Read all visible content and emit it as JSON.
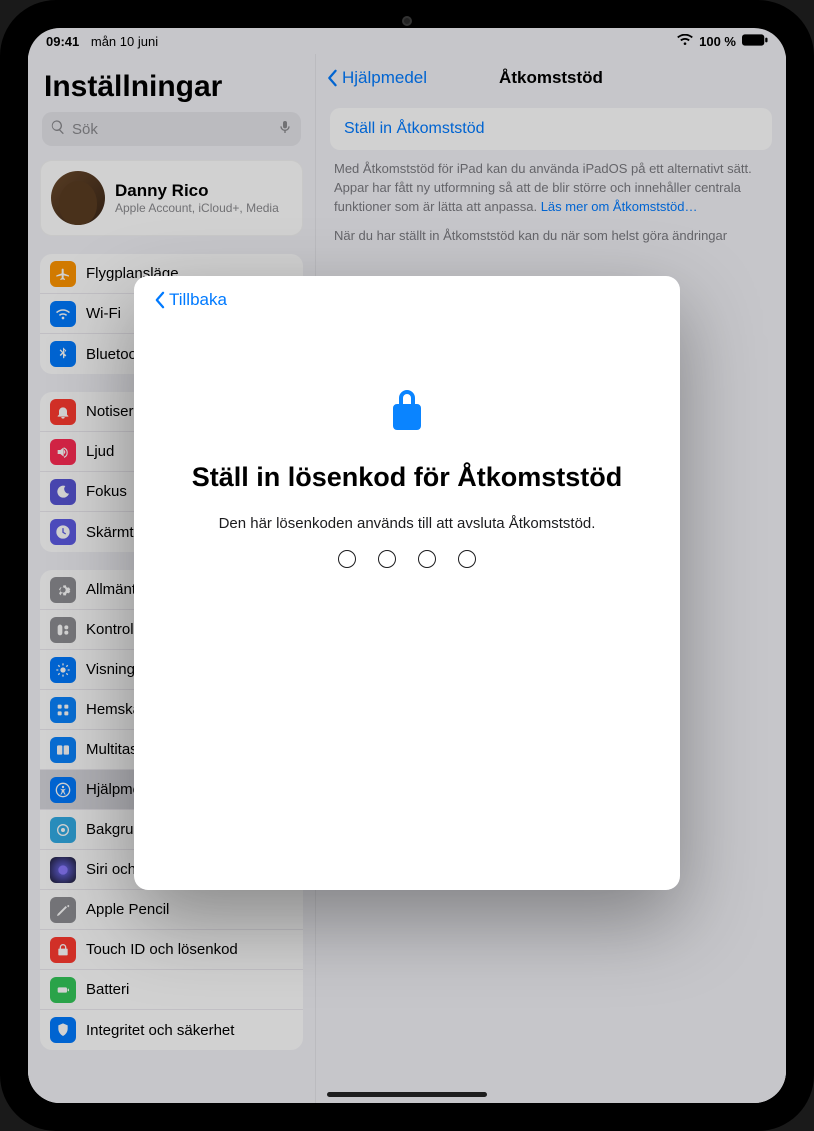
{
  "status": {
    "time": "09:41",
    "date": "mån 10 juni",
    "battery_pct": "100 %"
  },
  "sidebar": {
    "title": "Inställningar",
    "search_placeholder": "Sök",
    "profile": {
      "name": "Danny Rico",
      "sub": "Apple Account, iCloud+, Media"
    },
    "g1": [
      "Flygplansläge",
      "Wi-Fi",
      "Bluetooth"
    ],
    "g2": [
      "Notiser",
      "Ljud",
      "Fokus",
      "Skärmtid"
    ],
    "g3": [
      "Allmänt",
      "Kontrollcenter",
      "Visning och ljusstyrka",
      "Hemskärm och appbibliotek",
      "Multitasking och gester",
      "Hjälpmedel",
      "Bakgrundsbild",
      "Siri och sökning",
      "Apple Pencil",
      "Touch ID och lösenkod",
      "Batteri",
      "Integritet och säkerhet"
    ]
  },
  "detail": {
    "back": "Hjälpmedel",
    "title": "Åtkomststöd",
    "setup": "Ställ in Åtkomststöd",
    "desc1": "Med Åtkomststöd för iPad kan du använda iPadOS på ett alternativt sätt. Appar har fått ny utformning så att de blir större och innehåller centrala funktioner som är lätta att anpassa.",
    "learn": "Läs mer om Åtkomststöd…",
    "desc2": "När du har ställt in Åtkomststöd kan du när som helst göra ändringar"
  },
  "modal": {
    "back": "Tillbaka",
    "title": "Ställ in lösenkod för Åtkomststöd",
    "sub": "Den här lösenkoden används till att avsluta Åtkomststöd."
  }
}
